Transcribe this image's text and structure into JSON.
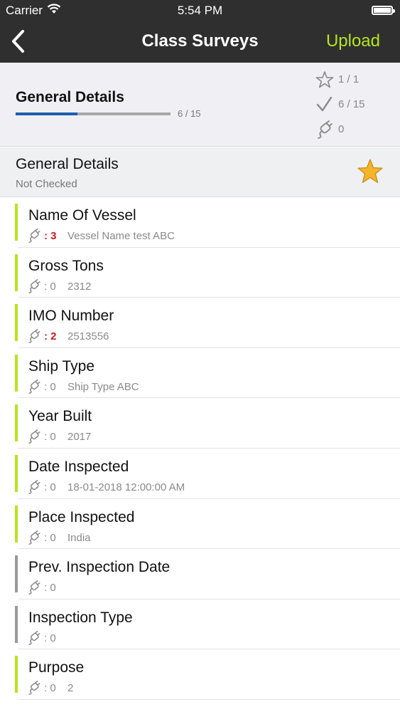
{
  "status_bar": {
    "carrier": "Carrier",
    "time": "5:54 PM"
  },
  "nav": {
    "title": "Class Surveys",
    "action": "Upload"
  },
  "summary": {
    "title": "General Details",
    "progress_label": "6 / 15",
    "progress_fraction": 0.4,
    "stats": [
      {
        "icon": "star-outline-icon",
        "value": "1 / 1"
      },
      {
        "icon": "checkmark-icon",
        "value": "6 / 15"
      },
      {
        "icon": "plug-icon",
        "value": "0"
      }
    ]
  },
  "section": {
    "title": "General Details",
    "subtitle": "Not Checked",
    "icon": "star-filled-icon"
  },
  "colors": {
    "accent_green": "#b5e61d",
    "progress_blue": "#1d5fa8",
    "count_red": "#d0191f",
    "bar_gray": "#999999"
  },
  "items": [
    {
      "label": "Name Of Vessel",
      "count": ": 3",
      "value": "Vessel Name test ABC",
      "answered": true,
      "has_issues": true
    },
    {
      "label": "Gross Tons",
      "count": ": 0",
      "value": "2312",
      "answered": true,
      "has_issues": false
    },
    {
      "label": "IMO Number",
      "count": ": 2",
      "value": "2513556",
      "answered": true,
      "has_issues": true
    },
    {
      "label": "Ship Type",
      "count": ": 0",
      "value": "Ship Type ABC",
      "answered": true,
      "has_issues": false
    },
    {
      "label": "Year Built",
      "count": ": 0",
      "value": "2017",
      "answered": true,
      "has_issues": false
    },
    {
      "label": "Date Inspected",
      "count": ": 0",
      "value": "18-01-2018 12:00:00 AM",
      "answered": true,
      "has_issues": false
    },
    {
      "label": "Place Inspected",
      "count": ": 0",
      "value": "India",
      "answered": true,
      "has_issues": false
    },
    {
      "label": "Prev. Inspection Date",
      "count": ": 0",
      "value": "",
      "answered": false,
      "has_issues": false
    },
    {
      "label": "Inspection Type",
      "count": ": 0",
      "value": "",
      "answered": false,
      "has_issues": false
    },
    {
      "label": "Purpose",
      "count": ": 0",
      "value": "2",
      "answered": true,
      "has_issues": false
    }
  ]
}
